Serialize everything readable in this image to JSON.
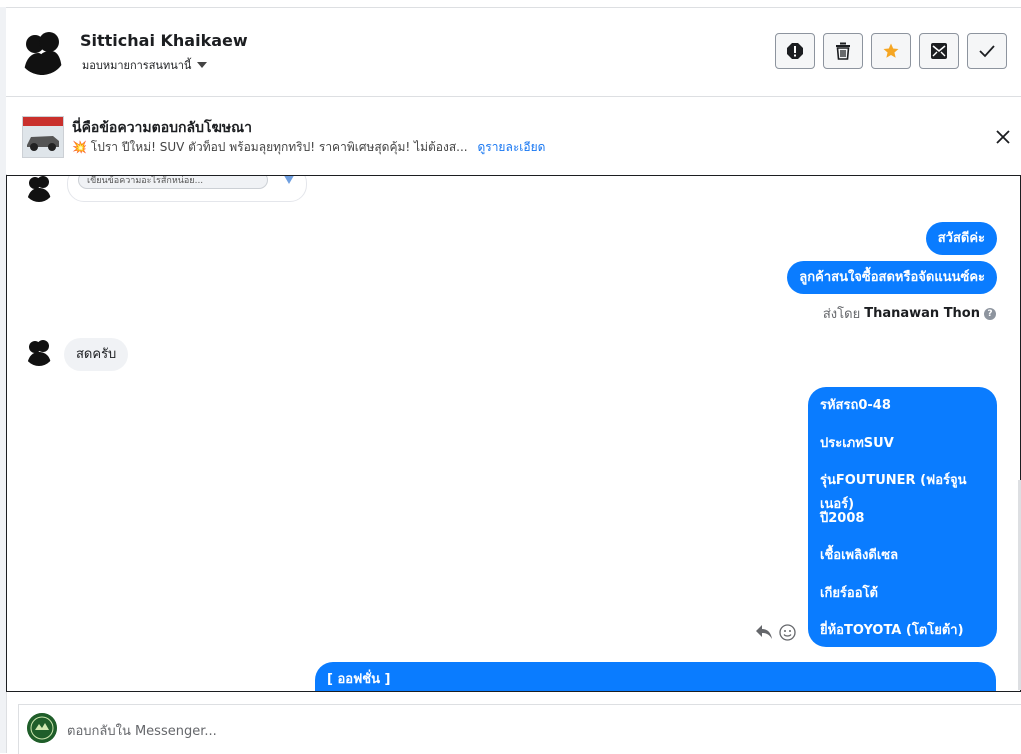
{
  "header": {
    "name": "Sittichai Khaikaew",
    "assign_label": "มอบหมายการสนทนานี้",
    "tools": [
      "alert-icon",
      "trash-icon",
      "star-icon",
      "mark-unread-icon",
      "check-icon"
    ],
    "star_color": "#f5a623"
  },
  "ad": {
    "title": "นี่คือข้อความตอบกลับโฆษณา",
    "text": "💥 โปรา ปีใหม่! SUV ตัวท็อป พร้อมลุยทุกทริป! ราคาพิเศษสุดคุ้ม! ไม่ต้องส...",
    "link": "ดูรายละเอียด"
  },
  "chat": {
    "comment_placeholder": "เขียนข้อความอะไรสักหน่อย...",
    "messages_out_1": [
      "สวัสดีค่ะ",
      "ลูกค้าสนใจซื้อสดหรือจัดแนนซ์คะ"
    ],
    "sent_by_prefix": "ส่งโดย",
    "sent_by_name": "Thanawan Thon",
    "message_in": "สดครับ",
    "car_details": [
      "รหัสรถ0-48",
      "ประเภทSUV",
      "รุ่นFOUTUNER (ฟอร์จูนเนอร์)",
      "ปี2008",
      "เชื้อเพลิงดีเซล",
      "เกียร์ออโต้",
      "ยี่ห้อTOYOTA (โตโยต้า)"
    ],
    "options_label": "[ ออฟชั่น ]",
    "bubble_color": "#0a7cff"
  },
  "reply": {
    "placeholder": "ตอบกลับใน Messenger..."
  }
}
